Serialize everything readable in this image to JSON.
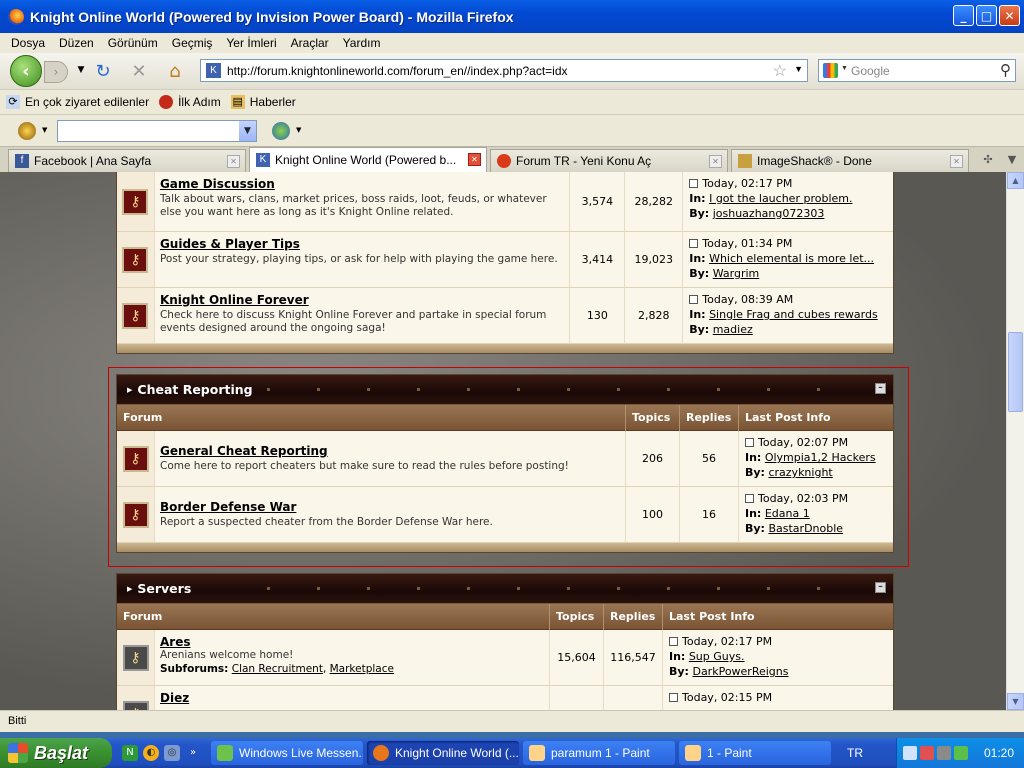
{
  "window": {
    "title": "Knight Online World (Powered by Invision Power Board) - Mozilla Firefox"
  },
  "menu": [
    "Dosya",
    "Düzen",
    "Görünüm",
    "Geçmiş",
    "Yer İmleri",
    "Araçlar",
    "Yardım"
  ],
  "nav": {
    "url": "http://forum.knightonlineworld.com/forum_en//index.php?act=idx",
    "search_placeholder": "Google"
  },
  "bookmarks": [
    "En çok ziyaret edilenler",
    "İlk Adım",
    "Haberler"
  ],
  "tabs": [
    {
      "label": "Facebook | Ana Sayfa",
      "icon": "facebook-icon",
      "color": "#3b5998"
    },
    {
      "label": "Knight Online World (Powered b...",
      "icon": "ko-icon",
      "color": "#3f63b0"
    },
    {
      "label": "Forum TR - Yeni Konu Aç",
      "icon": "forum-tr-icon",
      "color": "#d93a1a"
    },
    {
      "label": "ImageShack® - Done",
      "icon": "imageshack-icon",
      "color": "#c8a040"
    }
  ],
  "forum": {
    "top_rows": [
      {
        "name": "Game Discussion",
        "desc": "Talk about wars, clans, market prices, boss raids, loot, feuds, or whatever else you want here as long as it's Knight Online related.",
        "topics": "3,574",
        "replies": "28,282",
        "time": "Today, 02:17 PM",
        "in": "I got the laucher problem.",
        "by": "joshuazhang072303"
      },
      {
        "name": "Guides & Player Tips",
        "desc": "Post your strategy, playing tips, or ask for help with playing the game here.",
        "topics": "3,414",
        "replies": "19,023",
        "time": "Today, 01:34 PM",
        "in": "Which elemental is more let...",
        "by": "Wargrim"
      },
      {
        "name": "Knight Online Forever",
        "desc": "Check here to discuss Knight Online Forever and partake in special forum events designed around the ongoing saga!",
        "topics": "130",
        "replies": "2,828",
        "time": "Today, 08:39 AM",
        "in": "Single Frag and cubes rewards",
        "by": "madiez"
      }
    ],
    "cheat": {
      "title": "Cheat Reporting",
      "cols": [
        "Forum",
        "Topics",
        "Replies",
        "Last Post Info"
      ],
      "rows": [
        {
          "name": "General Cheat Reporting",
          "desc": "Come here to report cheaters but make sure to read the rules before posting!",
          "topics": "206",
          "replies": "56",
          "time": "Today, 02:07 PM",
          "in": "Olympia1,2 Hackers",
          "by": "crazyknight"
        },
        {
          "name": "Border Defense War",
          "desc": "Report a suspected cheater from the Border Defense War here.",
          "topics": "100",
          "replies": "16",
          "time": "Today, 02:03 PM",
          "in": "Edana 1",
          "by": "BastarDnoble"
        }
      ]
    },
    "servers": {
      "title": "Servers",
      "cols": [
        "Forum",
        "Topics",
        "Replies",
        "Last Post Info"
      ],
      "rows": [
        {
          "name": "Ares",
          "desc": "Arenians welcome home!",
          "subforums_label": "Subforums:",
          "sub1": "Clan Recruitment",
          "sub2": "Marketplace",
          "topics": "15,604",
          "replies": "116,547",
          "time": "Today, 02:17 PM",
          "in": "Sup Guys.",
          "by": "DarkPowerReigns"
        },
        {
          "name": "Diez",
          "time": "Today, 02:15 PM"
        }
      ]
    },
    "labels": {
      "in": "In:",
      "by": "By:"
    }
  },
  "status": "Bitti",
  "taskbar": {
    "start": "Başlat",
    "tasks": [
      "Windows Live Messen...",
      "Knight Online World (...",
      "paramum 1 - Paint",
      "1 - Paint"
    ],
    "lang": "TR",
    "clock": "01:20"
  }
}
